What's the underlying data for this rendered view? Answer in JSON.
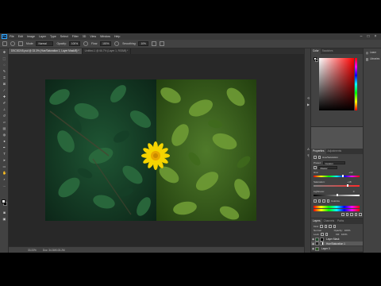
{
  "app": {
    "logo": "Ps"
  },
  "menu": [
    "File",
    "Edit",
    "Image",
    "Layer",
    "Type",
    "Select",
    "Filter",
    "3D",
    "View",
    "Window",
    "Help"
  ],
  "window_controls": {
    "minimize": "–",
    "maximize": "□",
    "close": "×"
  },
  "options": {
    "mode_label": "Mode:",
    "mode_value": "Normal",
    "opacity_label": "Opacity:",
    "opacity_value": "100%",
    "flow_label": "Flow:",
    "flow_value": "100%",
    "smoothing_label": "Smoothing:",
    "smoothing_value": "10%"
  },
  "tabs": [
    {
      "label": "DSC00245.psd @ 33.3% (Hue/Saturation 1, Layer Mask/8) *",
      "active": true
    },
    {
      "label": "Untitled-1 @ 66.7% (Layer 1, RGB/8) *",
      "active": false
    }
  ],
  "status": {
    "zoom": "33.33%",
    "doc": "Doc: 34.3M/103.2M"
  },
  "panels": {
    "color": {
      "tabs": [
        "Color",
        "Swatches"
      ]
    },
    "properties": {
      "tabs": [
        "Properties",
        "Adjustments"
      ],
      "title": "Hue/Saturation",
      "preset_label": "Preset:",
      "preset_value": "Custom",
      "channel_value": "Master",
      "hue_label": "Hue:",
      "hue_value": "+12",
      "saturation_label": "Saturation:",
      "saturation_value": "+18",
      "lightness_label": "Lightness:",
      "lightness_value": "0",
      "colorize_label": "Colorize"
    },
    "layers": {
      "tabs": [
        "Layers",
        "Channels",
        "Paths"
      ],
      "kind_label": "Kind",
      "blend_value": "Normal",
      "opacity_label": "Opacity:",
      "opacity_value": "100%",
      "lock_label": "Lock:",
      "fill_label": "Fill:",
      "fill_value": "100%",
      "items": [
        {
          "name": "Layer Mask",
          "selected": false
        },
        {
          "name": "Hue/Saturation 1",
          "selected": true
        },
        {
          "name": "Layer 0",
          "selected": false
        }
      ]
    }
  },
  "right_bar": [
    {
      "icon": "learn-icon",
      "label": "Learn"
    },
    {
      "icon": "libraries-icon",
      "label": "Libraries"
    }
  ],
  "colors": {
    "accent": "#31a8ff",
    "flower_center": "#e7a600",
    "flower_petal": "#f5d400"
  }
}
